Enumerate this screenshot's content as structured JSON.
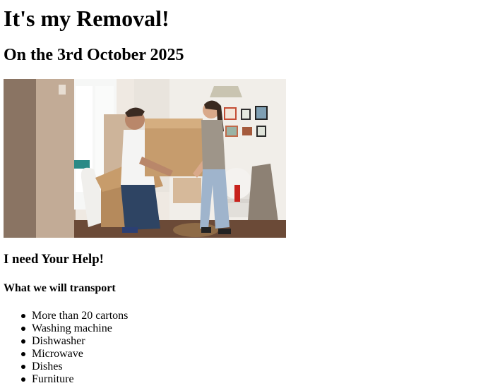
{
  "page": {
    "title": "It's my Removal!",
    "date_heading": "On the 3rd October 2025",
    "help_heading": "I need Your Help!",
    "transport_heading": "What we will transport"
  },
  "photo": {
    "alt": "Couple carrying moving boxes",
    "subject": "couple-carrying-boxes"
  },
  "transport_items": [
    "More than 20 cartons",
    "Washing machine",
    "Dishwasher",
    "Microwave",
    "Dishes",
    "Furniture"
  ]
}
